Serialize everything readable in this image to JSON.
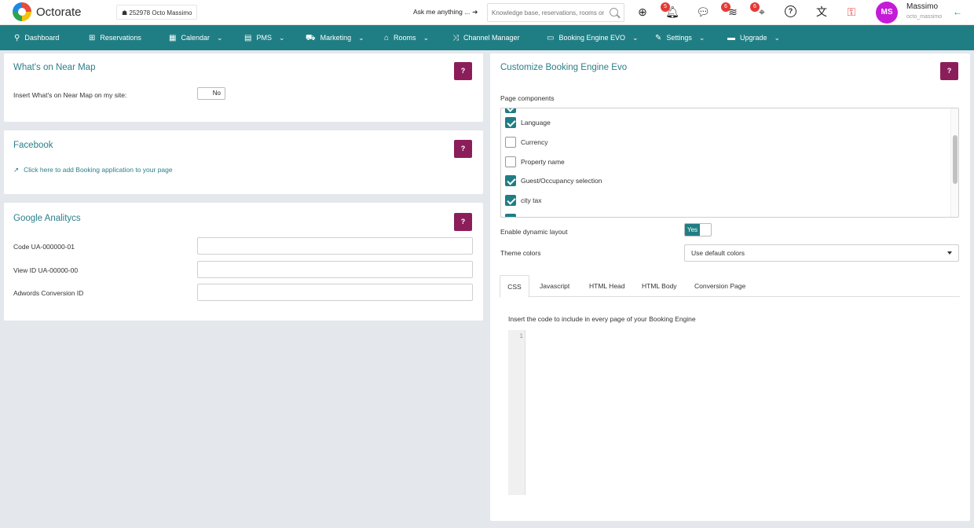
{
  "topbar": {
    "brand": "Octorate",
    "property": "☗ 252978  Octo Massimo",
    "ask_label": "Ask me anything ...",
    "ask_arrow": "➔",
    "search_placeholder": "Knowledge base, reservations, rooms or",
    "icons": [
      {
        "name": "add-circle-icon",
        "glyph": "⊕",
        "badge": ""
      },
      {
        "name": "bell-icon",
        "glyph": "🔔︎",
        "badge": "5"
      },
      {
        "name": "chat-icon",
        "glyph": "💬︎",
        "badge": ""
      },
      {
        "name": "feed-icon",
        "glyph": "≋",
        "badge": "6"
      },
      {
        "name": "crosshair-icon",
        "glyph": "⌖",
        "badge": "6"
      },
      {
        "name": "help-circle-icon",
        "glyph": "?",
        "badge": ""
      },
      {
        "name": "translate-icon",
        "glyph": "文",
        "badge": ""
      },
      {
        "name": "key-icon",
        "glyph": "⚿",
        "badge": ""
      }
    ],
    "avatar_initials": "MS",
    "user_name": "Massimo",
    "user_handle": "octo_massimo",
    "back_glyph": "←"
  },
  "nav": [
    {
      "label": "Dashboard",
      "icon": "⚲",
      "chev": ""
    },
    {
      "label": "Reservations",
      "icon": "⊞",
      "chev": ""
    },
    {
      "label": "Calendar",
      "icon": "▦",
      "chev": "⌄"
    },
    {
      "label": "PMS",
      "icon": "▤",
      "chev": "⌄"
    },
    {
      "label": "Marketing",
      "icon": "⛟",
      "chev": "⌄"
    },
    {
      "label": "Rooms",
      "icon": "⌂",
      "chev": "⌄"
    },
    {
      "label": "Channel Manager",
      "icon": "⤨",
      "chev": ""
    },
    {
      "label": "Booking Engine EVO",
      "icon": "▭",
      "chev": "⌄"
    },
    {
      "label": "Settings",
      "icon": "✎",
      "chev": "⌄"
    },
    {
      "label": "Upgrade",
      "icon": "▬",
      "chev": "⌄"
    }
  ],
  "whats_on": {
    "title": "What's on Near Map",
    "help": "?",
    "insert_label": "Insert What's on Near Map on my site:",
    "toggle_value": "No"
  },
  "facebook": {
    "title": "Facebook",
    "help": "?",
    "link_icon": "↗",
    "link_text": "Click here to add Booking application to your page"
  },
  "analytics": {
    "title": "Google Analitycs",
    "help": "?",
    "fields": [
      {
        "label": "Code UA-000000-01",
        "value": ""
      },
      {
        "label": "View ID UA-00000-00",
        "value": ""
      },
      {
        "label": "Adwords Conversion ID",
        "value": ""
      }
    ]
  },
  "booking": {
    "title": "Customize Booking Engine Evo",
    "help": "?",
    "components_label": "Page components",
    "components": [
      {
        "label": "Language",
        "checked": true
      },
      {
        "label": "Currency",
        "checked": false
      },
      {
        "label": "Property name",
        "checked": false
      },
      {
        "label": "Guest/Occupancy selection",
        "checked": true
      },
      {
        "label": "city tax",
        "checked": true
      }
    ],
    "dynamic_label": "Enable dynamic layout",
    "dynamic_value": "Yes",
    "theme_label": "Theme colors",
    "theme_value": "Use default colors",
    "tabs": [
      "CSS",
      "Javascript",
      "HTML Head",
      "HTML Body",
      "Conversion Page"
    ],
    "active_tab": "CSS",
    "code_hint": "Insert the code to include in every page of your Booking Engine",
    "line_number": "1"
  },
  "colors": {
    "accent": "#1f7e84",
    "help": "#8b1e5a",
    "avatar": "#c61ad9",
    "badge": "#e53935"
  }
}
